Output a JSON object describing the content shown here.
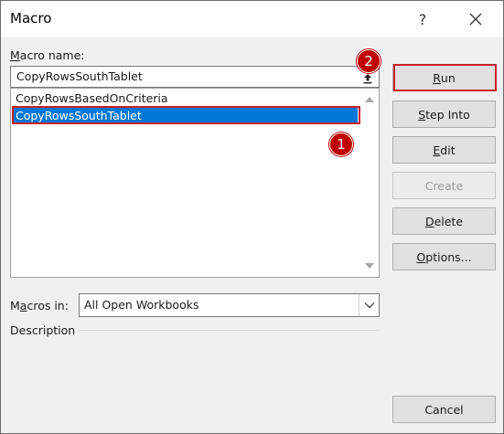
{
  "window": {
    "title": "Macro",
    "help_label": "?",
    "close_label": "✕"
  },
  "macro_name": {
    "label_prefix": "M",
    "label_rest": "acro name:",
    "value": "CopyRowsSouthTablet"
  },
  "macro_list": {
    "items": [
      "CopyRowsBasedOnCriteria",
      "CopyRowsSouthTablet"
    ],
    "selected_index": 1
  },
  "annotations": {
    "badge_1": "1",
    "badge_2": "2",
    "highlight_color": "#c8212b"
  },
  "buttons": {
    "run": {
      "mnemonic": "R",
      "rest": "un"
    },
    "step_into": {
      "mnemonic": "S",
      "rest": "tep Into"
    },
    "edit": {
      "mnemonic": "E",
      "rest": "dit"
    },
    "create": {
      "label": "Create",
      "enabled": false
    },
    "delete": {
      "mnemonic": "D",
      "rest": "elete"
    },
    "options": {
      "mnemonic": "O",
      "rest": "ptions..."
    },
    "cancel": {
      "label": "Cancel"
    }
  },
  "macros_in": {
    "label_pre": "M",
    "label_mid": "a",
    "label_post": "cros in:",
    "value": "All Open Workbooks"
  },
  "description": {
    "label": "Description"
  },
  "colors": {
    "selection": "#0078d7",
    "badge": "#c00000"
  }
}
